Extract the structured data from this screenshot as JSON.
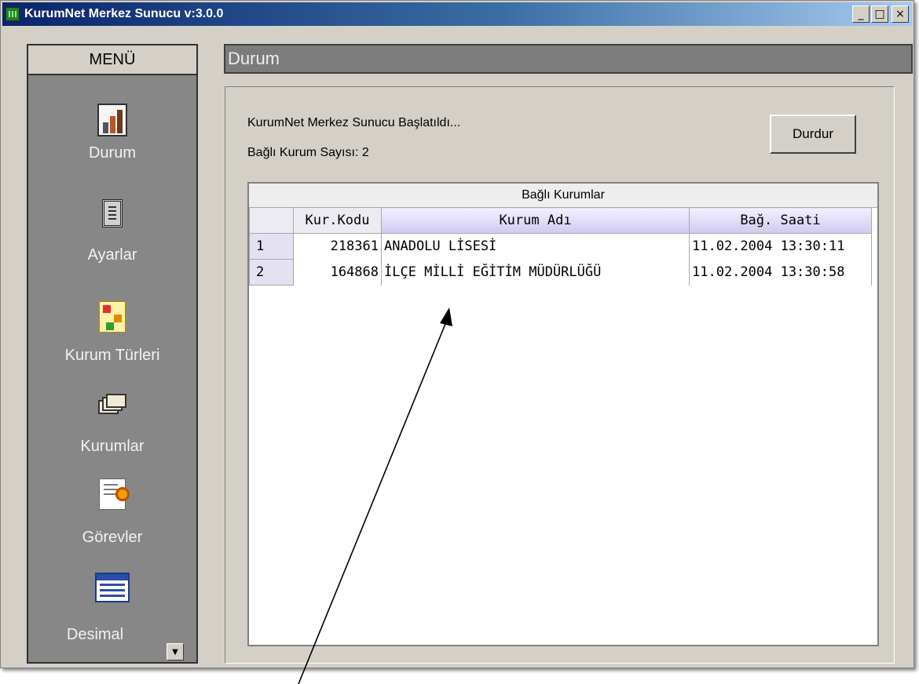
{
  "window": {
    "title": "KurumNet Merkez Sunucu v:3.0.0",
    "controls": {
      "minimize": "_",
      "maximize": "□",
      "close": "×"
    }
  },
  "sidebar": {
    "header": "MENÜ",
    "items": [
      {
        "label": "Durum",
        "icon": "status-chart-icon"
      },
      {
        "label": "Ayarlar",
        "icon": "settings-document-icon"
      },
      {
        "label": "Kurum Türleri",
        "icon": "institution-types-icon"
      },
      {
        "label": "Kurumlar",
        "icon": "institutions-stack-icon"
      },
      {
        "label": "Görevler",
        "icon": "tasks-icon"
      },
      {
        "label": "Desimal",
        "icon": "decimal-table-icon"
      }
    ],
    "scroll_arrow": "▼"
  },
  "main": {
    "title": "Durum",
    "status_message": "KurumNet Merkez Sunucu Başlatıldı...",
    "connected_count_text": "Bağlı Kurum Sayısı: 2",
    "stop_button": "Durdur",
    "table": {
      "caption": "Bağlı Kurumlar",
      "columns": [
        "",
        "Kur.Kodu",
        "Kurum Adı",
        "Bağ. Saati"
      ],
      "rows": [
        {
          "no": "1",
          "code": "218361",
          "name": "ANADOLU LİSESİ",
          "time": "11.02.2004 13:30:11"
        },
        {
          "no": "2",
          "code": "164868",
          "name": "İLÇE MİLLİ EĞİTİM MÜDÜRLÜĞÜ",
          "time": "11.02.2004 13:30:58"
        }
      ]
    }
  },
  "colors": {
    "title_bar": "#0a246a",
    "window_face": "#d4d0c8",
    "sidebar_bg": "#878787",
    "header_bg": "#7c7c7c",
    "selected_header": "#cfcaf0",
    "row_number_bg": "#e4e2f2"
  }
}
